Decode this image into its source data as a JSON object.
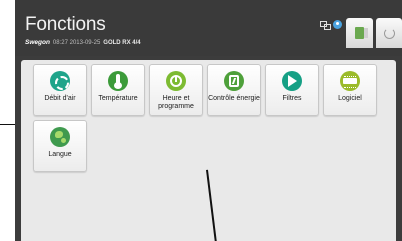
{
  "header": {
    "title": "Fonctions",
    "brand": "Swegon",
    "datetime": "08:27 2013-09-25",
    "unit": "GOLD RX  4/4"
  },
  "header_icons": [
    "network-icon",
    "user-icon"
  ],
  "header_buttons": [
    "door-exit-icon",
    "back-arrow-icon"
  ],
  "tiles": [
    {
      "label": "Débit d'air",
      "icon": "fan-icon",
      "color": "#1fa48a"
    },
    {
      "label": "Température",
      "icon": "thermometer-icon",
      "color": "#3c9b3a"
    },
    {
      "label": "Heure et programme",
      "icon": "clock-icon",
      "color": "#7dbb32"
    },
    {
      "label": "Contrôle énergie",
      "icon": "energy-icon",
      "color": "#4ea03a"
    },
    {
      "label": "Filtres",
      "icon": "filter-icon",
      "color": "#16a085"
    },
    {
      "label": "Logiciel",
      "icon": "software-icon",
      "color": "#9bbb2a"
    },
    {
      "label": "Langue",
      "icon": "globe-icon",
      "color": "#3f9a4e"
    }
  ]
}
